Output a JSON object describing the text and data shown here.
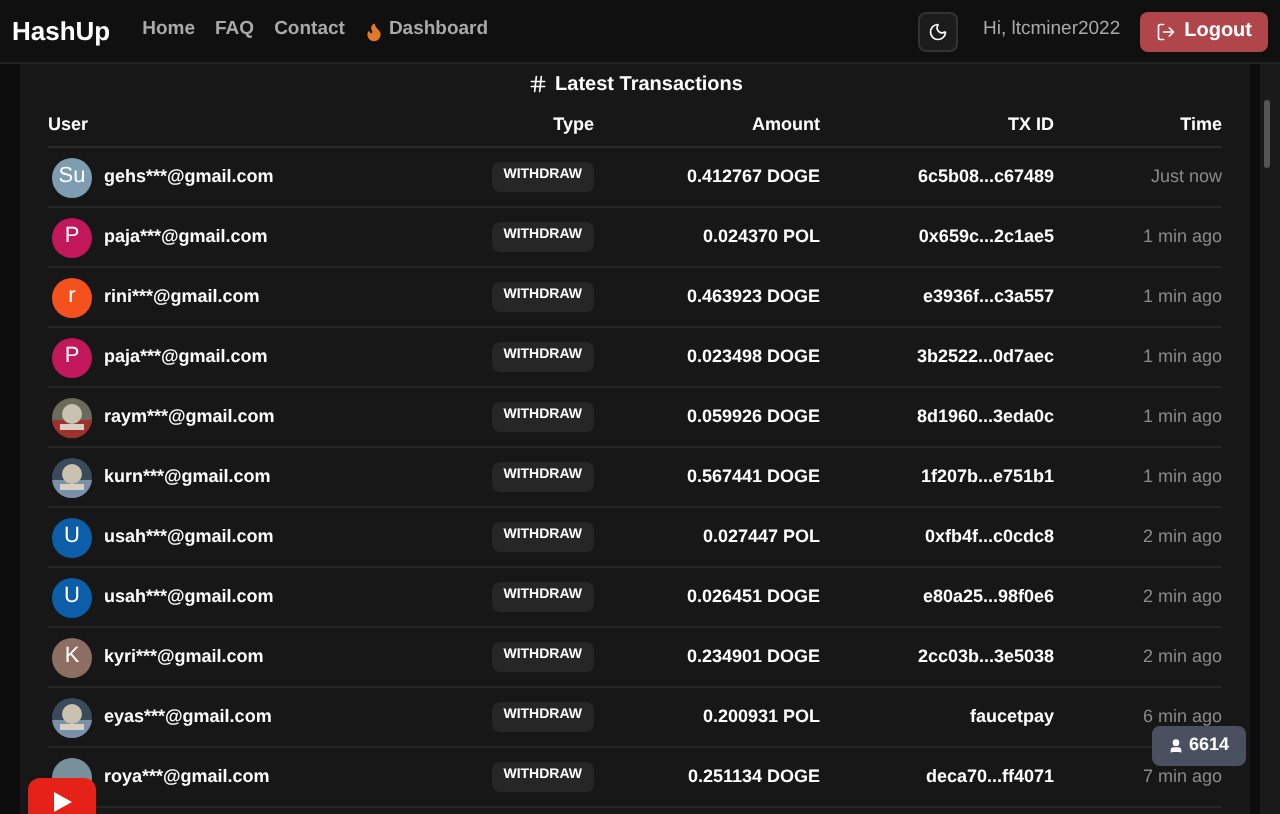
{
  "nav": {
    "brand": "HashUp",
    "links": [
      {
        "label": "Home",
        "kind": "text"
      },
      {
        "label": "FAQ",
        "kind": "text"
      },
      {
        "label": "Contact",
        "kind": "text"
      },
      {
        "label": "Dashboard",
        "kind": "flame"
      }
    ],
    "greeting": "Hi, ltcminer2022",
    "logout": "Logout"
  },
  "section": {
    "title": "Latest Transactions"
  },
  "table": {
    "columns": [
      "User",
      "Type",
      "Amount",
      "TX ID",
      "Time"
    ],
    "rows": [
      {
        "avatar": {
          "kind": "letter",
          "letter": "Su",
          "color": "#7f9db0"
        },
        "user": "gehs***@gmail.com",
        "type": "WITHDRAW",
        "amount": "0.412767 DOGE",
        "txid": "6c5b08...c67489",
        "time": "Just now"
      },
      {
        "avatar": {
          "kind": "letter",
          "letter": "P",
          "color": "#c2185b"
        },
        "user": "paja***@gmail.com",
        "type": "WITHDRAW",
        "amount": "0.024370 POL",
        "txid": "0x659c...2c1ae5",
        "time": "1 min ago"
      },
      {
        "avatar": {
          "kind": "letter",
          "letter": "r",
          "color": "#f4511e"
        },
        "user": "rini***@gmail.com",
        "type": "WITHDRAW",
        "amount": "0.463923 DOGE",
        "txid": "e3936f...c3a557",
        "time": "1 min ago"
      },
      {
        "avatar": {
          "kind": "letter",
          "letter": "P",
          "color": "#c2185b"
        },
        "user": "paja***@gmail.com",
        "type": "WITHDRAW",
        "amount": "0.023498 DOGE",
        "txid": "3b2522...0d7aec",
        "time": "1 min ago"
      },
      {
        "user": "raym***@gmail.com",
        "type": "WITHDRAW",
        "amount": "0.059926 DOGE",
        "txid": "8d1960...3eda0c",
        "time": "1 min ago"
      },
      {
        "user": "kurn***@gmail.com",
        "type": "WITHDRAW",
        "amount": "0.567441 DOGE",
        "txid": "1f207b...e751b1",
        "time": "1 min ago"
      },
      {
        "avatar": {
          "kind": "letter",
          "letter": "U",
          "color": "#0d5ea8"
        },
        "user": "usah***@gmail.com",
        "type": "WITHDRAW",
        "amount": "0.027447 POL",
        "txid": "0xfb4f...c0cdc8",
        "time": "2 min ago"
      },
      {
        "avatar": {
          "kind": "letter",
          "letter": "U",
          "color": "#0d5ea8"
        },
        "user": "usah***@gmail.com",
        "type": "WITHDRAW",
        "amount": "0.026451 DOGE",
        "txid": "e80a25...98f0e6",
        "time": "2 min ago"
      },
      {
        "avatar": {
          "kind": "letter",
          "letter": "K",
          "color": "#8d6e63"
        },
        "user": "kyri***@gmail.com",
        "type": "WITHDRAW",
        "amount": "0.234901 DOGE",
        "txid": "2cc03b...3e5038",
        "time": "2 min ago"
      },
      {
        "user": "eyas***@gmail.com",
        "type": "WITHDRAW",
        "amount": "0.200931 POL",
        "txid": "faucetpay",
        "time": "6 min ago"
      },
      {
        "avatar": {
          "kind": "letter",
          "color": "#78909c"
        },
        "user": "roya***@gmail.com",
        "type": "WITHDRAW",
        "amount": "0.251134 DOGE",
        "txid": "deca70...ff4071",
        "time": "7 min ago"
      }
    ]
  },
  "online_badge": "6614"
}
